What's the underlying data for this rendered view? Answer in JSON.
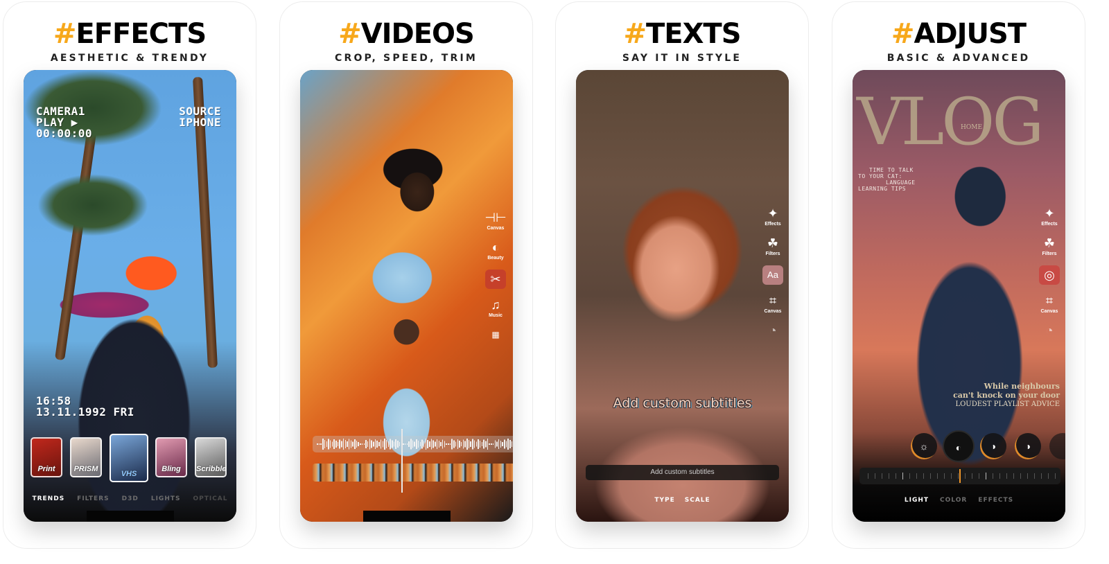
{
  "accent_color": "#f7a81b",
  "panels": [
    {
      "hash": "#",
      "title": "EFFECTS",
      "subtitle": "AESTHETIC & TRENDY",
      "overlay": {
        "top_left": [
          "CAMERA1",
          "PLAY ▶",
          "00:00:00"
        ],
        "top_right": [
          "SOURCE",
          "IPHONE"
        ],
        "bottom_left": [
          "16:58",
          "13.11.1992 FRI"
        ]
      },
      "thumbnails": [
        {
          "label": "Print"
        },
        {
          "label": "PRISM"
        },
        {
          "label": "VHS",
          "selected": true
        },
        {
          "label": "Bling"
        },
        {
          "label": "Scribble"
        }
      ],
      "tabs": [
        {
          "label": "TRENDS",
          "active": true
        },
        {
          "label": "FILTERS"
        },
        {
          "label": "D3D"
        },
        {
          "label": "LIGHTS"
        },
        {
          "label": "OPTICAL"
        }
      ]
    },
    {
      "hash": "#",
      "title": "VIDEOS",
      "subtitle": "CROP, SPEED, TRIM",
      "tools": [
        {
          "icon": "canvas-icon",
          "glyph": "⊣⊢",
          "label": "Canvas"
        },
        {
          "icon": "beauty-icon",
          "glyph": "◐",
          "label": "Beauty"
        },
        {
          "icon": "scissors-icon",
          "glyph": "✂",
          "label": "",
          "active": true
        },
        {
          "icon": "music-icon",
          "glyph": "♫",
          "label": "Music"
        },
        {
          "icon": "film-icon",
          "glyph": "▦",
          "label": ""
        }
      ]
    },
    {
      "hash": "#",
      "title": "TEXTS",
      "subtitle": "SAY IT IN STYLE",
      "tools": [
        {
          "icon": "effects-icon",
          "glyph": "✦",
          "label": "Effects"
        },
        {
          "icon": "filters-icon",
          "glyph": "☘",
          "label": "Filters"
        },
        {
          "icon": "text-icon",
          "glyph": "Aa",
          "label": "",
          "active": true
        },
        {
          "icon": "crop-icon",
          "glyph": "⌗",
          "label": "Canvas"
        },
        {
          "icon": "more-icon",
          "glyph": "◔",
          "label": ""
        }
      ],
      "subtitle_preview": "Add custom subtitles",
      "subtitle_input": "Add custom subtitles",
      "tabs": [
        {
          "label": "TYPE",
          "active": true
        },
        {
          "label": "SCALE",
          "active": true
        }
      ]
    },
    {
      "hash": "#",
      "title": "ADJUST",
      "subtitle": "BASIC & ADVANCED",
      "magazine": {
        "masthead": "VLOG",
        "home": "HOME",
        "small_text": [
          "TIME TO TALK",
          "TO YOUR CAT:",
          "LANGUAGE",
          "LEARNING TIPS"
        ],
        "quote_lines": [
          "While neighbours",
          "can't knock on your door"
        ],
        "caption": "LOUDEST PLAYLIST ADVICE"
      },
      "tools": [
        {
          "icon": "effects-icon",
          "glyph": "✦",
          "label": "Effects"
        },
        {
          "icon": "filters-icon",
          "glyph": "☘",
          "label": "Filters"
        },
        {
          "icon": "adjust-icon",
          "glyph": "◎",
          "label": "",
          "active": true
        },
        {
          "icon": "crop-icon",
          "glyph": "⌗",
          "label": "Canvas"
        },
        {
          "icon": "more-icon",
          "glyph": "◔",
          "label": ""
        }
      ],
      "dials": [
        {
          "icon": "brightness-icon",
          "glyph": "☼"
        },
        {
          "icon": "contrast-icon",
          "glyph": "◐",
          "selected": true
        },
        {
          "icon": "highlights-icon",
          "glyph": "◑"
        },
        {
          "icon": "shadows-icon",
          "glyph": "◑"
        }
      ],
      "slider_value": 0.5,
      "tabs": [
        {
          "label": "LIGHT",
          "active": true
        },
        {
          "label": "COLOR"
        },
        {
          "label": "EFFECTS"
        }
      ]
    }
  ]
}
